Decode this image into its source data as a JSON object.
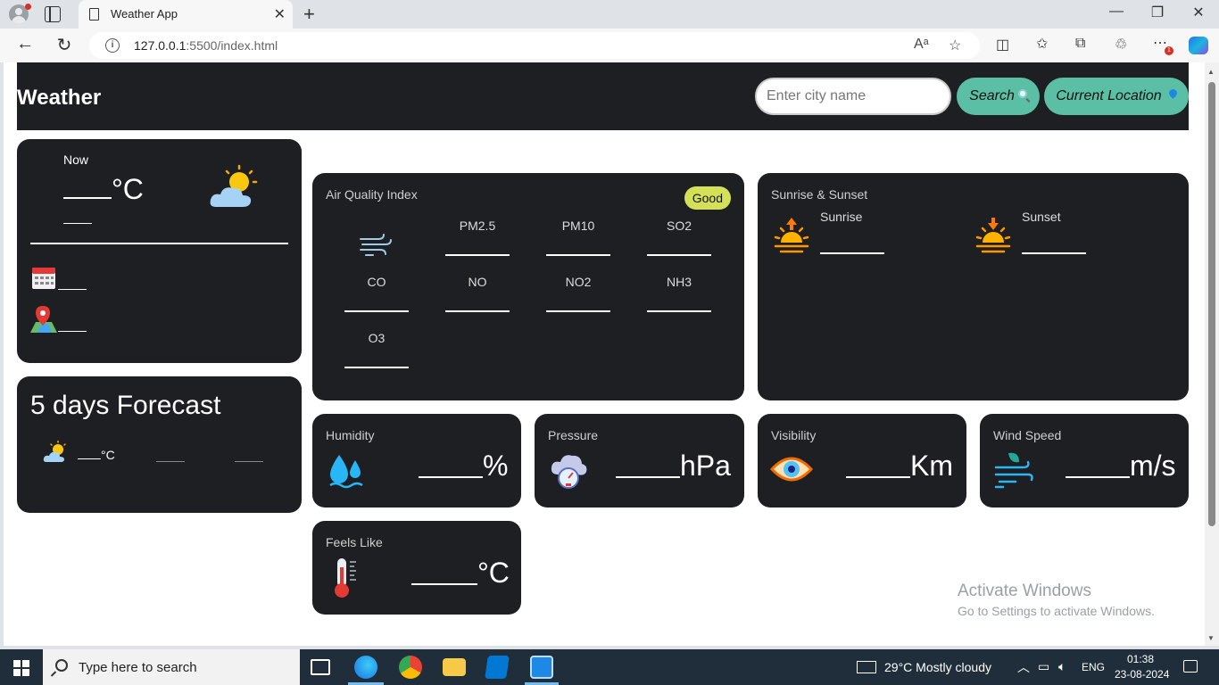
{
  "browser": {
    "tab_title": "Weather App",
    "url_host": "127.0.0.1",
    "url_rest": ":5500/index.html",
    "extension_badge": "1"
  },
  "header": {
    "brand": "Weather",
    "search_placeholder": "Enter city name",
    "search_label": "Search",
    "location_label": "Current Location"
  },
  "current": {
    "now_label": "Now",
    "temp_unit": "°C"
  },
  "forecast": {
    "title": "5 days Forecast",
    "temp_unit": "°C"
  },
  "aqi": {
    "title": "Air Quality Index",
    "status": "Good",
    "pollutants": [
      "PM2.5",
      "PM10",
      "SO2",
      "CO",
      "NO",
      "NO2",
      "NH3",
      "O3"
    ]
  },
  "sun": {
    "title": "Sunrise & Sunset",
    "sunrise_label": "Sunrise",
    "sunset_label": "Sunset"
  },
  "stats": {
    "humidity": {
      "title": "Humidity",
      "unit": "%"
    },
    "pressure": {
      "title": "Pressure",
      "unit": "hPa"
    },
    "visibility": {
      "title": "Visibility",
      "unit": "Km"
    },
    "wind": {
      "title": "Wind Speed",
      "unit": "m/s"
    },
    "feels_like": {
      "title": "Feels Like",
      "unit": "°C"
    }
  },
  "watermark": {
    "line1": "Activate Windows",
    "line2": "Go to Settings to activate Windows."
  },
  "taskbar": {
    "search_placeholder": "Type here to search",
    "weather": "29°C  Mostly cloudy",
    "language": "ENG",
    "time": "01:38",
    "date": "23-08-2024"
  },
  "colors": {
    "card_bg": "#1e1f22",
    "button_bg": "#5bbfa6",
    "badge_good": "#d4e157"
  }
}
